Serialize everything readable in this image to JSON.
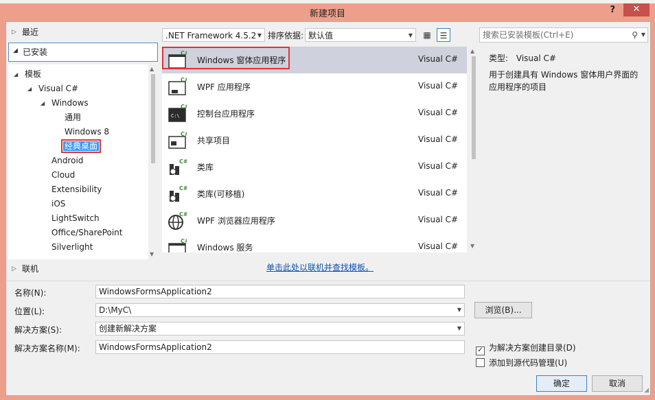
{
  "window": {
    "title": "新建项目",
    "help": "?",
    "close": "✕"
  },
  "left": {
    "recent": "最近",
    "installed": "已安装",
    "online": "联机",
    "tree": [
      "模板",
      "Visual C#",
      "Windows",
      "通用",
      "Windows 8",
      "经典桌面",
      "Android",
      "Cloud",
      "Extensibility",
      "iOS",
      "LightSwitch",
      "Office/SharePoint",
      "Silverlight"
    ]
  },
  "toolbar": {
    "framework": ".NET Framework 4.5.2",
    "sort_label": "排序依据:",
    "sort_value": "默认值",
    "search_placeholder": "搜索已安装模板(Ctrl+E)"
  },
  "templates": [
    {
      "name": "Windows 窗体应用程序",
      "lang": "Visual C#",
      "icon": "windows-form-icon"
    },
    {
      "name": "WPF 应用程序",
      "lang": "Visual C#",
      "icon": "wpf-app-icon"
    },
    {
      "name": "控制台应用程序",
      "lang": "Visual C#",
      "icon": "console-app-icon"
    },
    {
      "name": "共享项目",
      "lang": "Visual C#",
      "icon": "shared-project-icon"
    },
    {
      "name": "类库",
      "lang": "Visual C#",
      "icon": "class-library-icon"
    },
    {
      "name": "类库(可移植)",
      "lang": "Visual C#",
      "icon": "portable-library-icon"
    },
    {
      "name": "WPF 浏览器应用程序",
      "lang": "Visual C#",
      "icon": "wpf-browser-icon"
    },
    {
      "name": "Windows 服务",
      "lang": "Visual C#",
      "icon": "windows-service-icon"
    }
  ],
  "details": {
    "type_label": "类型:",
    "type_value": "Visual C#",
    "description": "用于创建具有 Windows 窗体用户界面的应用程序的项目"
  },
  "online_link": "单击此处以联机并查找模板。",
  "form": {
    "name_label": "名称(N):",
    "name_value": "WindowsFormsApplication2",
    "location_label": "位置(L):",
    "location_value": "D:\\MyC\\",
    "browse": "浏览(B)...",
    "solution_label": "解决方案(S):",
    "solution_value": "创建新解决方案",
    "solution_name_label": "解决方案名称(M):",
    "solution_name_value": "WindowsFormsApplication2",
    "create_dir": "为解决方案创建目录(D)",
    "create_dir_checked": true,
    "source_control": "添加到源代码管理(U)",
    "source_control_checked": false,
    "ok": "确定",
    "cancel": "取消"
  }
}
